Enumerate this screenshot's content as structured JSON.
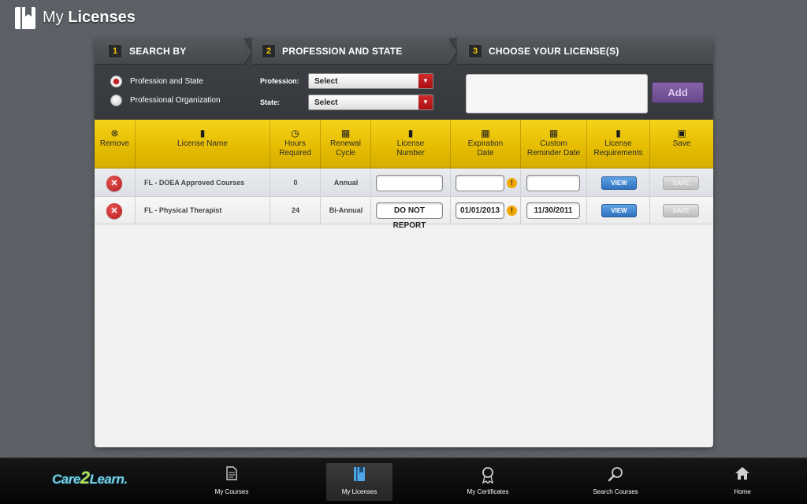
{
  "header": {
    "title_light": "My",
    "title_bold": "Licenses"
  },
  "steps": [
    {
      "number": "1",
      "label": "SEARCH BY"
    },
    {
      "number": "2",
      "label": "PROFESSION AND STATE"
    },
    {
      "number": "3",
      "label": "CHOOSE YOUR LICENSE(S)"
    }
  ],
  "search_by": {
    "options": [
      {
        "label": "Profession and State",
        "selected": true
      },
      {
        "label": "Professional Organization",
        "selected": false
      }
    ]
  },
  "profession_state": {
    "profession_label": "Profession:",
    "profession_value": "Select",
    "state_label": "State:",
    "state_value": "Select"
  },
  "choose": {
    "add_label": "Add"
  },
  "table": {
    "headers": [
      {
        "icon": "remove-icon",
        "label": "Remove"
      },
      {
        "icon": "bookmark-icon",
        "label": "License Name"
      },
      {
        "icon": "clock-icon",
        "label": "Hours Required"
      },
      {
        "icon": "calendar-icon",
        "label": "Renewal Cycle"
      },
      {
        "icon": "bookmark-icon",
        "label": "License Number"
      },
      {
        "icon": "calendar-icon",
        "label": "Expiration Date"
      },
      {
        "icon": "calendar-icon",
        "label": "Custom Reminder Date"
      },
      {
        "icon": "bookmark-icon",
        "label": "License Requirements"
      },
      {
        "icon": "floppy-disk-icon",
        "label": "Save"
      }
    ],
    "rows": [
      {
        "name": "FL - DOEA Approved Courses",
        "hours": "0",
        "cycle": "Annual",
        "license_number": "",
        "expiration": "",
        "reminder": "",
        "view": "VIEW",
        "save": "SAVE"
      },
      {
        "name": "FL - Physical Therapist",
        "hours": "24",
        "cycle": "Bi-Annual",
        "license_number": "DO NOT REPORT",
        "expiration": "01/01/2013",
        "reminder": "11/30/2011",
        "view": "VIEW",
        "save": "SAVE"
      }
    ]
  },
  "bottom_nav": {
    "brand": {
      "part1": "Care",
      "part2": "2",
      "part3": "Learn",
      "mark": "."
    },
    "items": [
      {
        "label": "My Courses",
        "icon": "document-icon",
        "active": false
      },
      {
        "label": "My Licenses",
        "icon": "license-book-icon",
        "active": true
      },
      {
        "label": "My Certificates",
        "icon": "award-ribbon-icon",
        "active": false
      },
      {
        "label": "Search Courses",
        "icon": "magnifier-icon",
        "active": false
      },
      {
        "label": "Home",
        "icon": "home-icon",
        "active": false
      }
    ]
  },
  "colors": {
    "accent_yellow": "#e6bd02",
    "add_purple": "#6a488c",
    "view_blue": "#2f72c0",
    "remove_red": "#c3232b"
  }
}
